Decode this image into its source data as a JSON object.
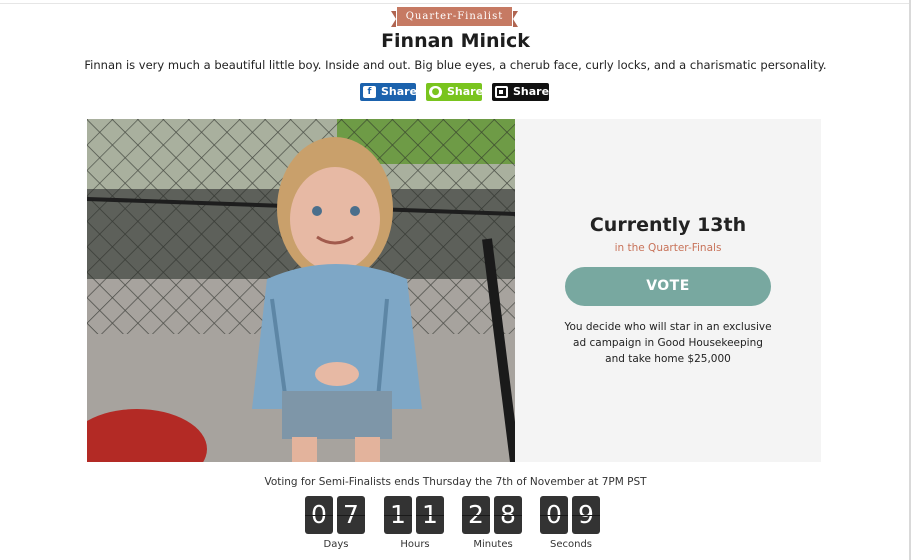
{
  "contestant": {
    "badge": "Quarter-Finalist",
    "name": "Finnan Minick",
    "bio": "Finnan is very much a beautiful little boy. Inside and out. Big blue eyes, a cherub face, curly locks, and a charismatic personality."
  },
  "share": [
    {
      "label": "Share",
      "icon": "facebook-icon",
      "color": "#1b62ad"
    },
    {
      "label": "Share",
      "icon": "imessage-icon",
      "color": "#79c41e"
    },
    {
      "label": "Share",
      "icon": "qr-code-icon",
      "color": "#111111"
    }
  ],
  "panel": {
    "rank": "Currently 13th",
    "round": "in the Quarter-Finals",
    "vote_label": "VOTE",
    "pitch": "You decide who will star in an exclusive ad campaign in Good Housekeeping and take home $25,000"
  },
  "countdown": {
    "deadline": "Voting for Semi-Finalists ends Thursday the 7th of November at 7PM PST",
    "units": [
      {
        "digits": [
          "0",
          "7"
        ],
        "label": "Days"
      },
      {
        "digits": [
          "1",
          "1"
        ],
        "label": "Hours"
      },
      {
        "digits": [
          "2",
          "8"
        ],
        "label": "Minutes"
      },
      {
        "digits": [
          "0",
          "9"
        ],
        "label": "Seconds"
      }
    ]
  },
  "colors": {
    "accent": "#c67a63",
    "vote": "#78a8a0",
    "panel_bg": "#f4f4f4"
  }
}
